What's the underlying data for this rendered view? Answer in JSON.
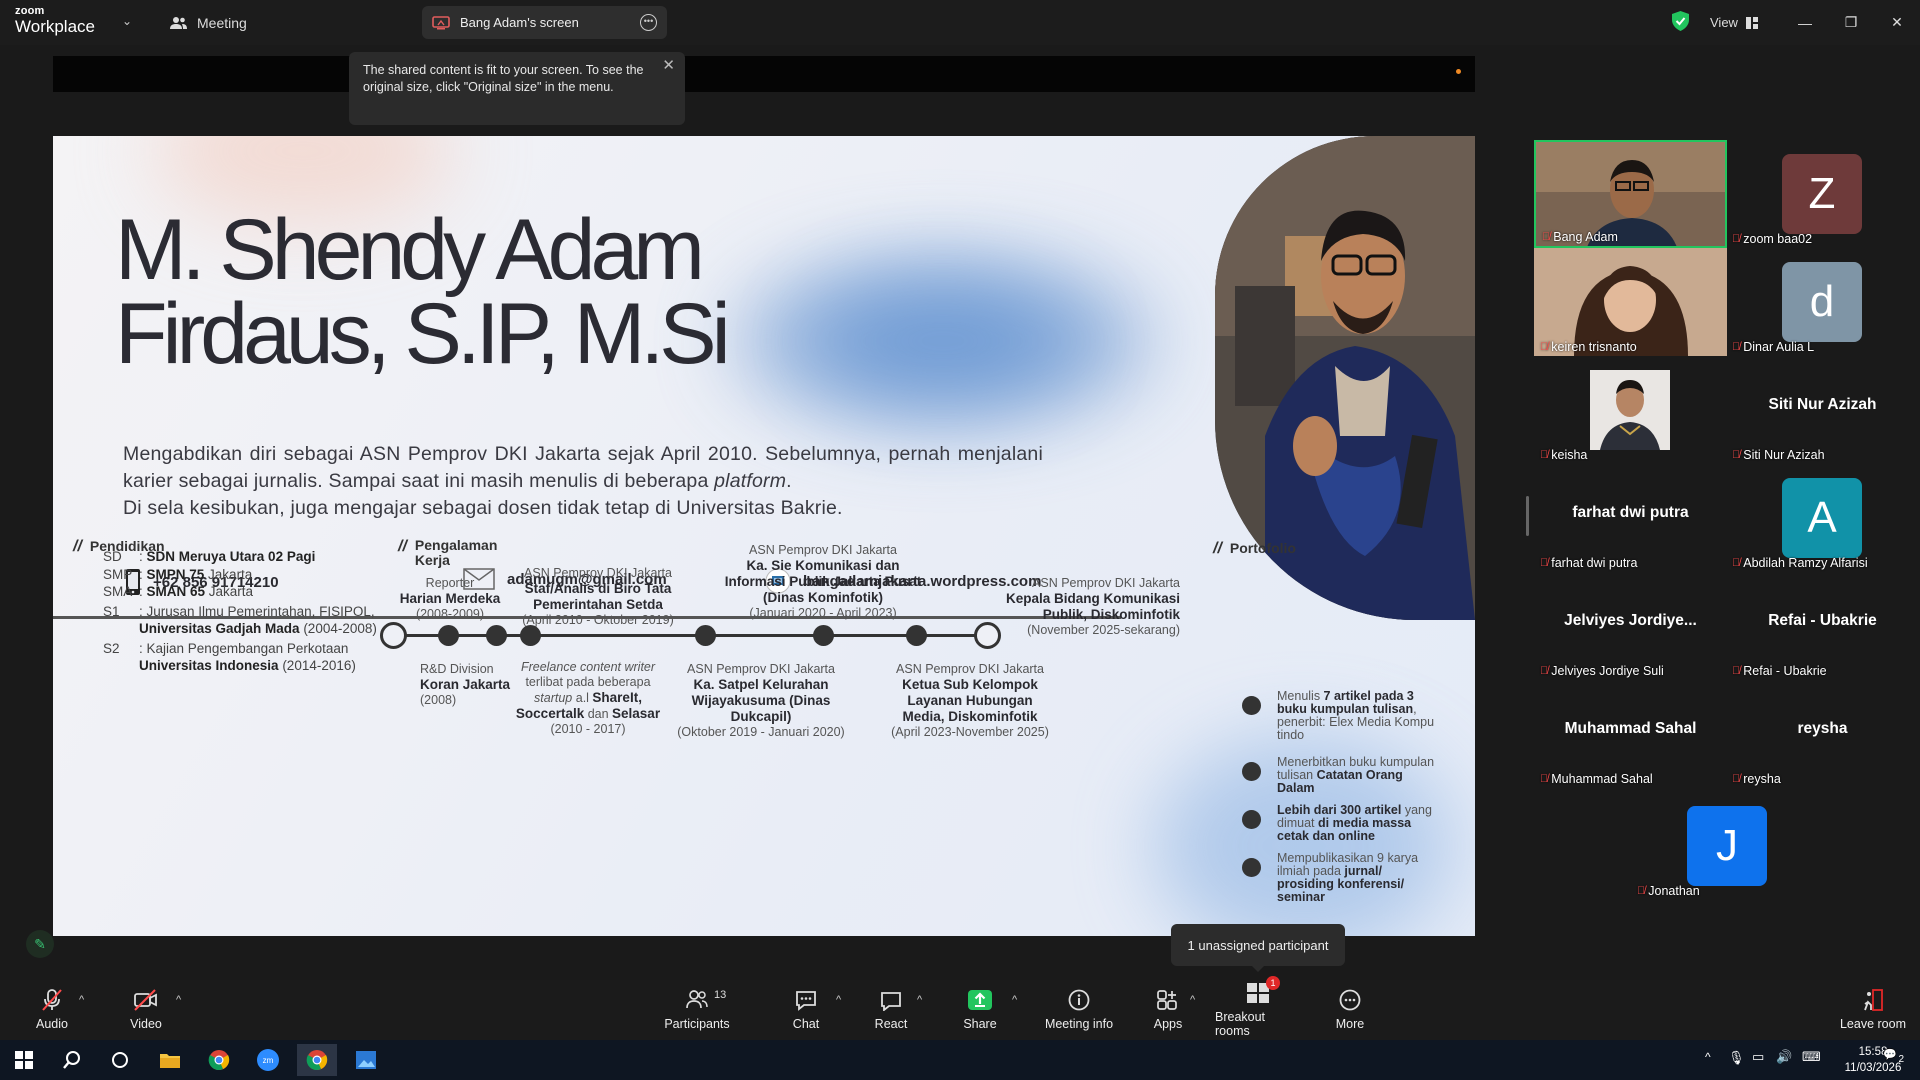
{
  "app": {
    "brand_top": "zoom",
    "brand_bottom": "Workplace"
  },
  "topbar": {
    "meeting_label": "Meeting",
    "screen_tab_label": "Bang Adam's screen",
    "view_label": "View"
  },
  "tooltip": {
    "text": "The shared content is fit to your screen. To see the original size, click \"Original size\" in the menu."
  },
  "slide": {
    "title_line1": "M. Shendy Adam",
    "title_line2": "Firdaus, S.IP, M.Si",
    "bio_line1": "Mengabdikan diri sebagai ASN Pemprov DKI Jakarta sejak April 2010. Sebelumnya, pernah menjalani karier sebagai jurnalis. Sampai saat ini masih menulis di beberapa",
    "bio_italic": "platform",
    "bio_line2": "Di sela kesibukan, juga mengajar sebagai  dosen tidak tetap di Universitas Bakrie.",
    "phone": "+62 856 91714210",
    "email": "adamugm@gmail.com",
    "website": "bangadamjakarta.wordpress.com",
    "edu_heading": "Pendidikan",
    "edu": [
      {
        "k": "SD",
        "bold": "SDN Meruya Utara 02 Pagi",
        "rest": ""
      },
      {
        "k": "SMP",
        "bold": "SMPN 75",
        "rest": " Jakarta"
      },
      {
        "k": "SMA",
        "bold": "SMAN 65",
        "rest": " Jakarta"
      },
      {
        "k": "S1",
        "pre": "Jurusan Ilmu Pemerintahan, FISIPOL, ",
        "bold": "Universitas Gadjah Mada",
        "rest": " (2004-2008)"
      },
      {
        "k": "S2",
        "pre": "Kajian Pengembangan Perkotaan ",
        "bold": "Universitas Indonesia",
        "rest": " (2014-2016)"
      }
    ],
    "work_heading_1": "Pengalaman",
    "work_heading_2": "Kerja",
    "tl_top": [
      {
        "small": "Reporter",
        "bold": "Harian Merdeka",
        "date": "(2008-2009)"
      },
      {
        "small": "ASN Pemprov DKI Jakarta",
        "bold": "Staf/Analis di Biro Tata Pemerintahan Setda",
        "date": "(April 2010 - Oktober 2019)"
      },
      {
        "small": "ASN Pemprov DKI Jakarta",
        "bold": "Ka. Sie Komunikasi dan Informasi Publik Jakarta Pusat (Dinas Kominfotik)",
        "date": "(Januari 2020 - April 2023)"
      },
      {
        "small": "ASN Pemprov DKI Jakarta",
        "bold": "Kepala Bidang Komunikasi Publik, Diskominfotik",
        "date": "(November 2025-sekarang)"
      }
    ],
    "tl_bottom": [
      {
        "small": "R&D Division",
        "bold": "Koran Jakarta",
        "date": "(2008)"
      },
      {
        "small": "Freelance content writer",
        "desc": "terlibat pada beberapa",
        "startup": "startup",
        "desc2": " a.l ",
        "bold": "ShareIt, Soccertalk",
        "and": " dan ",
        "bold2": "Selasar",
        "date": "(2010 - 2017)"
      },
      {
        "small": "ASN Pemprov DKI Jakarta",
        "bold": "Ka. Satpel Kelurahan Wijayakusuma (Dinas Dukcapil)",
        "date": "(Oktober 2019 - Januari 2020)"
      },
      {
        "small": "ASN Pemprov DKI Jakarta",
        "bold": "Ketua Sub Kelompok Layanan Hubungan Media, Diskominfotik",
        "date": "(April 2023-November 2025)"
      }
    ],
    "port_heading": "Portofolio",
    "port": [
      {
        "pre": "Menulis ",
        "bold": "7 artikel pada 3 buku kumpulan tulisan",
        "rest": ", penerbit: Elex Media Kompu tindo"
      },
      {
        "pre": "Menerbitkan buku kumpulan tulisan ",
        "bold": "Catatan Orang Dalam",
        "rest": ""
      },
      {
        "pre": "",
        "bold": "Lebih dari 300 artikel",
        "rest": " yang dimuat ",
        "bold2": "di media massa cetak dan online"
      },
      {
        "pre": "Mempublikasikan 9 karya ilmiah pada ",
        "bold": "jurnal/ prosiding konferensi/ seminar",
        "rest": ""
      }
    ]
  },
  "participants_gallery": [
    {
      "name": "Bang Adam",
      "type": "video"
    },
    {
      "name": "zoom baa02",
      "type": "avatar",
      "letter": "Z",
      "color": "#6e3a3a"
    },
    {
      "name": "keiren trisnanto",
      "type": "video"
    },
    {
      "name": "Dinar Aulia L",
      "type": "avatar",
      "letter": "d",
      "color": "#7f95a6"
    },
    {
      "name": "keisha",
      "type": "photo"
    },
    {
      "name": "Siti Nur Azizah",
      "type": "name",
      "display": "Siti Nur Azizah"
    },
    {
      "name": "farhat dwi putra",
      "type": "name",
      "display": "farhat dwi putra"
    },
    {
      "name": "Abdilah Ramzy Alfarisi",
      "type": "avatar",
      "letter": "A",
      "color": "#1192a8"
    },
    {
      "name": "Jelviyes Jordiye Suli",
      "type": "name",
      "display": "Jelviyes  Jordiye..."
    },
    {
      "name": "Refai - Ubakrie",
      "type": "name",
      "display": "Refai - Ubakrie"
    },
    {
      "name": "Muhammad Sahal",
      "type": "name",
      "display": "Muhammad Sahal"
    },
    {
      "name": "reysha",
      "type": "name",
      "display": "reysha"
    },
    {
      "name": "Jonathan",
      "type": "avatar",
      "letter": "J",
      "color": "#0e72ed"
    }
  ],
  "unassigned": "1 unassigned participant",
  "toolbar": {
    "audio": "Audio",
    "video": "Video",
    "participants": "Participants",
    "participants_count": "13",
    "chat": "Chat",
    "react": "React",
    "share": "Share",
    "meeting_info": "Meeting info",
    "apps": "Apps",
    "breakout": "Breakout rooms",
    "breakout_badge": "1",
    "more": "More",
    "leave": "Leave room"
  },
  "taskbar": {
    "time": "15:58",
    "date": "11/03/2026",
    "notif": "2"
  },
  "colors": {
    "accent_green": "#22c55e",
    "mic_off": "#ff4b4b",
    "zoom_blue": "#0e72ed"
  }
}
